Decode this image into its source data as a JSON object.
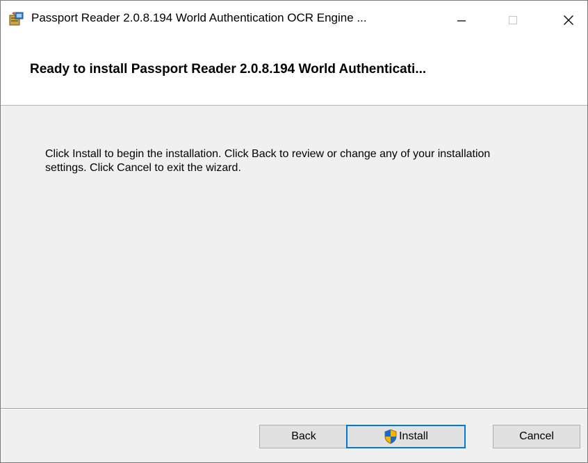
{
  "window": {
    "title": "Passport Reader 2.0.8.194 World Authentication OCR Engine ...",
    "app_icon": "installer-package-icon",
    "controls": {
      "minimize_icon": "minimize-icon",
      "maximize_icon": "maximize-icon",
      "close_icon": "close-icon"
    }
  },
  "header": {
    "title": "Ready to install Passport Reader 2.0.8.194 World Authenticati..."
  },
  "body": {
    "text": "Click Install to begin the installation. Click Back to review or change any of your installation settings. Click Cancel to exit the wizard."
  },
  "footer": {
    "back_label": "Back",
    "install_label": "Install",
    "install_icon": "uac-shield-icon",
    "cancel_label": "Cancel"
  },
  "colors": {
    "focus_border": "#0078d7",
    "button_bg": "#e1e1e1",
    "dialog_bg": "#f0f0f0"
  }
}
